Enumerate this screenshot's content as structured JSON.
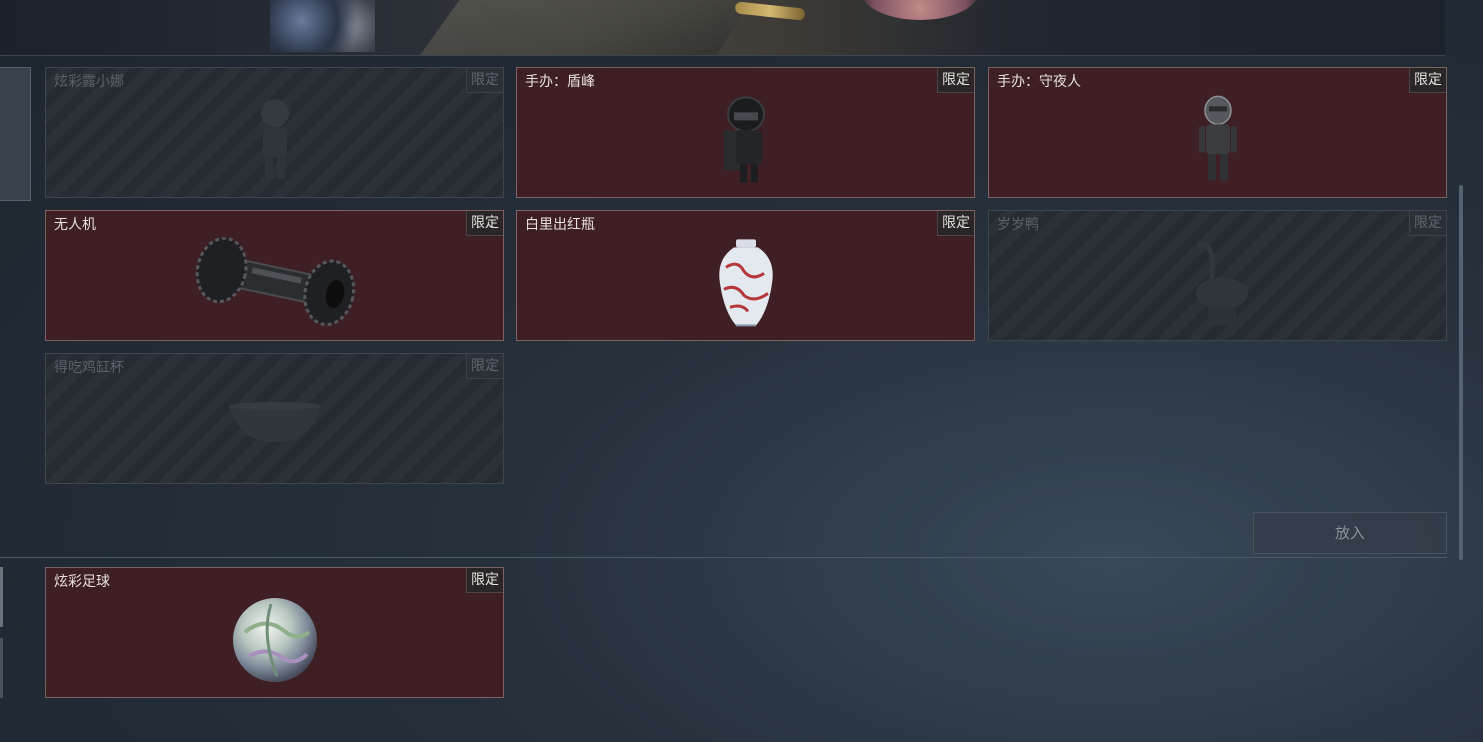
{
  "cards": [
    {
      "name": "炫彩露小娜",
      "badge": "限定",
      "icon": "figure-silhouette-icon",
      "state": "locked"
    },
    {
      "name": "手办：盾峰",
      "badge": "限定",
      "icon": "armored-soldier-figure-icon",
      "state": "active"
    },
    {
      "name": "手办：守夜人",
      "badge": "限定",
      "icon": "robot-soldier-figure-icon",
      "state": "active"
    },
    {
      "name": "无人机",
      "badge": "限定",
      "icon": "drone-icon",
      "state": "active"
    },
    {
      "name": "白里出红瓶",
      "badge": "限定",
      "icon": "porcelain-vase-icon",
      "state": "active"
    },
    {
      "name": "岁岁鸭",
      "badge": "限定",
      "icon": "duck-statue-icon",
      "state": "locked"
    },
    {
      "name": "得吃鸡缸杯",
      "badge": "限定",
      "icon": "cup-icon",
      "state": "locked"
    }
  ],
  "place_button_label": "放入",
  "selected": {
    "name": "炫彩足球",
    "badge": "限定",
    "icon": "iridescent-football-icon",
    "state": "active"
  },
  "colors": {
    "active_card": "#3e1f24",
    "locked_card": "#262b31"
  }
}
